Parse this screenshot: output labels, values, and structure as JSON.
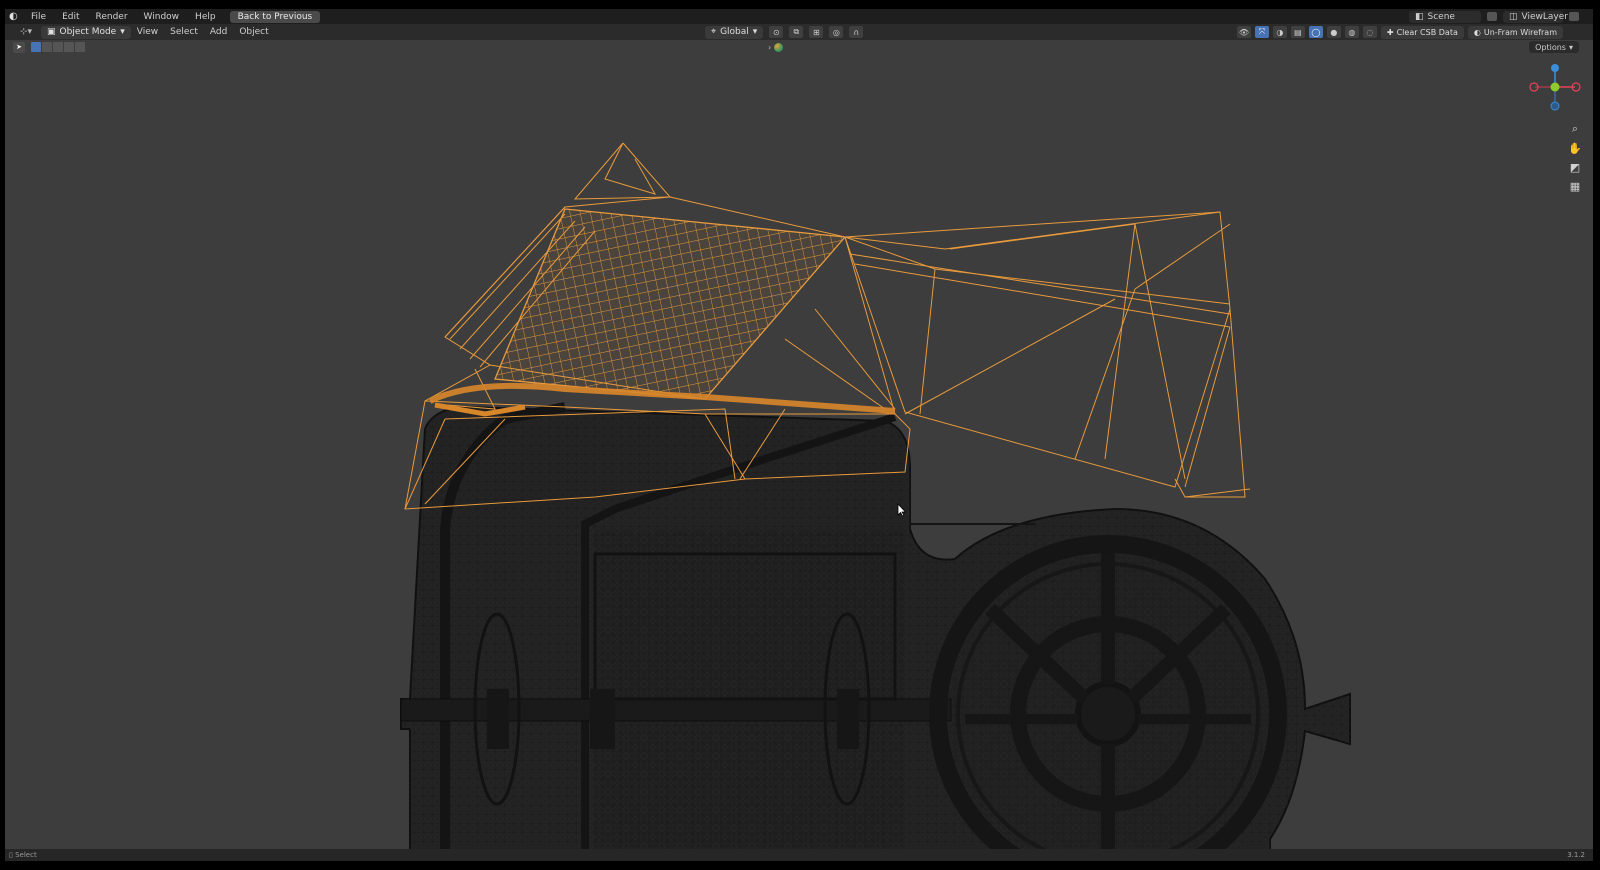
{
  "topbar": {
    "menus": [
      "File",
      "Edit",
      "Render",
      "Window",
      "Help"
    ],
    "back_button": "Back to Previous",
    "scene_label": "Scene",
    "view_layer_label": "ViewLayer"
  },
  "viewport_header": {
    "mode": "Object Mode",
    "menus": [
      "View",
      "Select",
      "Add",
      "Object"
    ],
    "transform_orientation": "Global",
    "clear_cust_btn": "Clear CSB Data",
    "unfreeze_btn": "Un-Fram Wirefram"
  },
  "toolrow": {
    "options": "Options"
  },
  "nav_gizmo": {
    "axis_colors": {
      "x": "#e8425a",
      "y": "#8ccc2c",
      "z": "#3b8ed9"
    }
  },
  "nav_icons": [
    "zoom-icon",
    "hand-pan-icon",
    "camera-icon",
    "grid-icon"
  ],
  "statusbar": {
    "left": "Select",
    "right": "3.1.2"
  },
  "colors": {
    "selected_wire": "#e89a3c",
    "unselected_wire": "#1a1a1a",
    "background": "#3d3d3d"
  }
}
